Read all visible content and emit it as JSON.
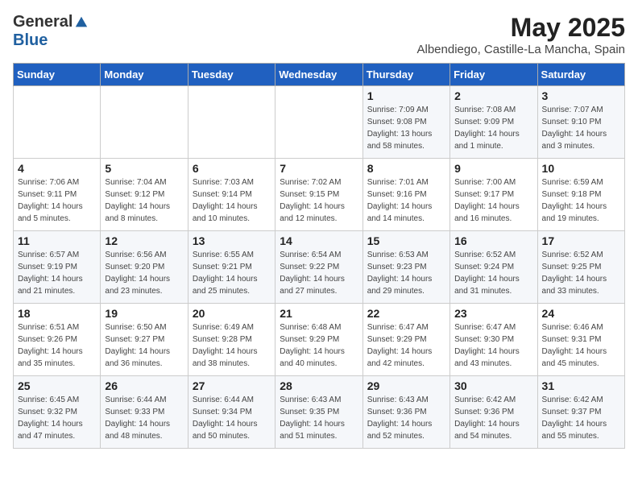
{
  "logo": {
    "general": "General",
    "blue": "Blue"
  },
  "title": "May 2025",
  "subtitle": "Albendiego, Castille-La Mancha, Spain",
  "days_of_week": [
    "Sunday",
    "Monday",
    "Tuesday",
    "Wednesday",
    "Thursday",
    "Friday",
    "Saturday"
  ],
  "weeks": [
    [
      {
        "day": "",
        "sunrise": "",
        "sunset": "",
        "daylight": ""
      },
      {
        "day": "",
        "sunrise": "",
        "sunset": "",
        "daylight": ""
      },
      {
        "day": "",
        "sunrise": "",
        "sunset": "",
        "daylight": ""
      },
      {
        "day": "",
        "sunrise": "",
        "sunset": "",
        "daylight": ""
      },
      {
        "day": "1",
        "sunrise": "7:09 AM",
        "sunset": "9:08 PM",
        "daylight": "13 hours and 58 minutes."
      },
      {
        "day": "2",
        "sunrise": "7:08 AM",
        "sunset": "9:09 PM",
        "daylight": "14 hours and 1 minute."
      },
      {
        "day": "3",
        "sunrise": "7:07 AM",
        "sunset": "9:10 PM",
        "daylight": "14 hours and 3 minutes."
      }
    ],
    [
      {
        "day": "4",
        "sunrise": "7:06 AM",
        "sunset": "9:11 PM",
        "daylight": "14 hours and 5 minutes."
      },
      {
        "day": "5",
        "sunrise": "7:04 AM",
        "sunset": "9:12 PM",
        "daylight": "14 hours and 8 minutes."
      },
      {
        "day": "6",
        "sunrise": "7:03 AM",
        "sunset": "9:14 PM",
        "daylight": "14 hours and 10 minutes."
      },
      {
        "day": "7",
        "sunrise": "7:02 AM",
        "sunset": "9:15 PM",
        "daylight": "14 hours and 12 minutes."
      },
      {
        "day": "8",
        "sunrise": "7:01 AM",
        "sunset": "9:16 PM",
        "daylight": "14 hours and 14 minutes."
      },
      {
        "day": "9",
        "sunrise": "7:00 AM",
        "sunset": "9:17 PM",
        "daylight": "14 hours and 16 minutes."
      },
      {
        "day": "10",
        "sunrise": "6:59 AM",
        "sunset": "9:18 PM",
        "daylight": "14 hours and 19 minutes."
      }
    ],
    [
      {
        "day": "11",
        "sunrise": "6:57 AM",
        "sunset": "9:19 PM",
        "daylight": "14 hours and 21 minutes."
      },
      {
        "day": "12",
        "sunrise": "6:56 AM",
        "sunset": "9:20 PM",
        "daylight": "14 hours and 23 minutes."
      },
      {
        "day": "13",
        "sunrise": "6:55 AM",
        "sunset": "9:21 PM",
        "daylight": "14 hours and 25 minutes."
      },
      {
        "day": "14",
        "sunrise": "6:54 AM",
        "sunset": "9:22 PM",
        "daylight": "14 hours and 27 minutes."
      },
      {
        "day": "15",
        "sunrise": "6:53 AM",
        "sunset": "9:23 PM",
        "daylight": "14 hours and 29 minutes."
      },
      {
        "day": "16",
        "sunrise": "6:52 AM",
        "sunset": "9:24 PM",
        "daylight": "14 hours and 31 minutes."
      },
      {
        "day": "17",
        "sunrise": "6:52 AM",
        "sunset": "9:25 PM",
        "daylight": "14 hours and 33 minutes."
      }
    ],
    [
      {
        "day": "18",
        "sunrise": "6:51 AM",
        "sunset": "9:26 PM",
        "daylight": "14 hours and 35 minutes."
      },
      {
        "day": "19",
        "sunrise": "6:50 AM",
        "sunset": "9:27 PM",
        "daylight": "14 hours and 36 minutes."
      },
      {
        "day": "20",
        "sunrise": "6:49 AM",
        "sunset": "9:28 PM",
        "daylight": "14 hours and 38 minutes."
      },
      {
        "day": "21",
        "sunrise": "6:48 AM",
        "sunset": "9:29 PM",
        "daylight": "14 hours and 40 minutes."
      },
      {
        "day": "22",
        "sunrise": "6:47 AM",
        "sunset": "9:29 PM",
        "daylight": "14 hours and 42 minutes."
      },
      {
        "day": "23",
        "sunrise": "6:47 AM",
        "sunset": "9:30 PM",
        "daylight": "14 hours and 43 minutes."
      },
      {
        "day": "24",
        "sunrise": "6:46 AM",
        "sunset": "9:31 PM",
        "daylight": "14 hours and 45 minutes."
      }
    ],
    [
      {
        "day": "25",
        "sunrise": "6:45 AM",
        "sunset": "9:32 PM",
        "daylight": "14 hours and 47 minutes."
      },
      {
        "day": "26",
        "sunrise": "6:44 AM",
        "sunset": "9:33 PM",
        "daylight": "14 hours and 48 minutes."
      },
      {
        "day": "27",
        "sunrise": "6:44 AM",
        "sunset": "9:34 PM",
        "daylight": "14 hours and 50 minutes."
      },
      {
        "day": "28",
        "sunrise": "6:43 AM",
        "sunset": "9:35 PM",
        "daylight": "14 hours and 51 minutes."
      },
      {
        "day": "29",
        "sunrise": "6:43 AM",
        "sunset": "9:36 PM",
        "daylight": "14 hours and 52 minutes."
      },
      {
        "day": "30",
        "sunrise": "6:42 AM",
        "sunset": "9:36 PM",
        "daylight": "14 hours and 54 minutes."
      },
      {
        "day": "31",
        "sunrise": "6:42 AM",
        "sunset": "9:37 PM",
        "daylight": "14 hours and 55 minutes."
      }
    ]
  ],
  "labels": {
    "sunrise": "Sunrise:",
    "sunset": "Sunset:",
    "daylight": "Daylight:"
  }
}
